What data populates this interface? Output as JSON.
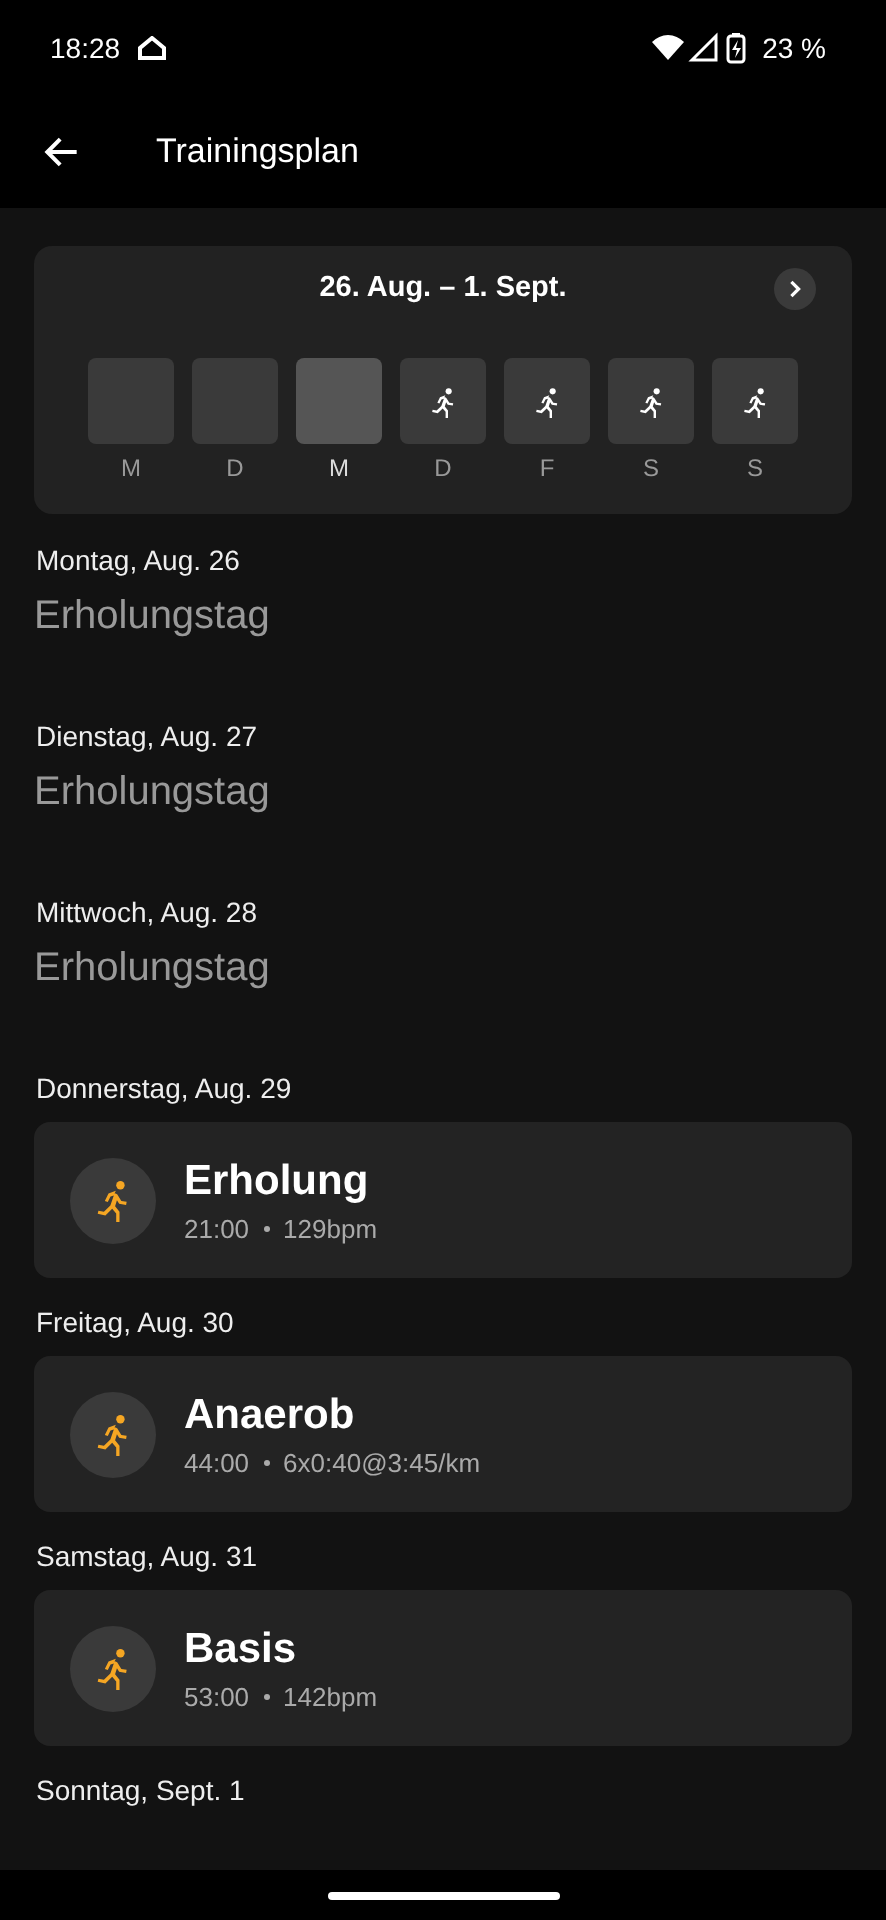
{
  "status_bar": {
    "time": "18:28",
    "battery": "23 %"
  },
  "app_bar": {
    "title": "Trainingsplan"
  },
  "week": {
    "range": "26. Aug. – 1. Sept.",
    "days": [
      {
        "label": "M",
        "selected": false,
        "workout": false
      },
      {
        "label": "D",
        "selected": false,
        "workout": false
      },
      {
        "label": "M",
        "selected": true,
        "workout": false
      },
      {
        "label": "D",
        "selected": false,
        "workout": true
      },
      {
        "label": "F",
        "selected": false,
        "workout": true
      },
      {
        "label": "S",
        "selected": false,
        "workout": true
      },
      {
        "label": "S",
        "selected": false,
        "workout": true
      }
    ]
  },
  "schedule": [
    {
      "date": "Montag, Aug. 26",
      "kind": "rest",
      "title": "Erholungstag"
    },
    {
      "date": "Dienstag, Aug. 27",
      "kind": "rest",
      "title": "Erholungstag"
    },
    {
      "date": "Mittwoch, Aug. 28",
      "kind": "rest",
      "title": "Erholungstag"
    },
    {
      "date": "Donnerstag, Aug. 29",
      "kind": "workout",
      "title": "Erholung",
      "duration": "21:00",
      "target": "129bpm"
    },
    {
      "date": "Freitag, Aug. 30",
      "kind": "workout",
      "title": "Anaerob",
      "duration": "44:00",
      "target": "6x0:40@3:45/km"
    },
    {
      "date": "Samstag, Aug. 31",
      "kind": "workout",
      "title": "Basis",
      "duration": "53:00",
      "target": "142bpm"
    },
    {
      "date": "Sonntag, Sept. 1",
      "kind": "header"
    }
  ]
}
